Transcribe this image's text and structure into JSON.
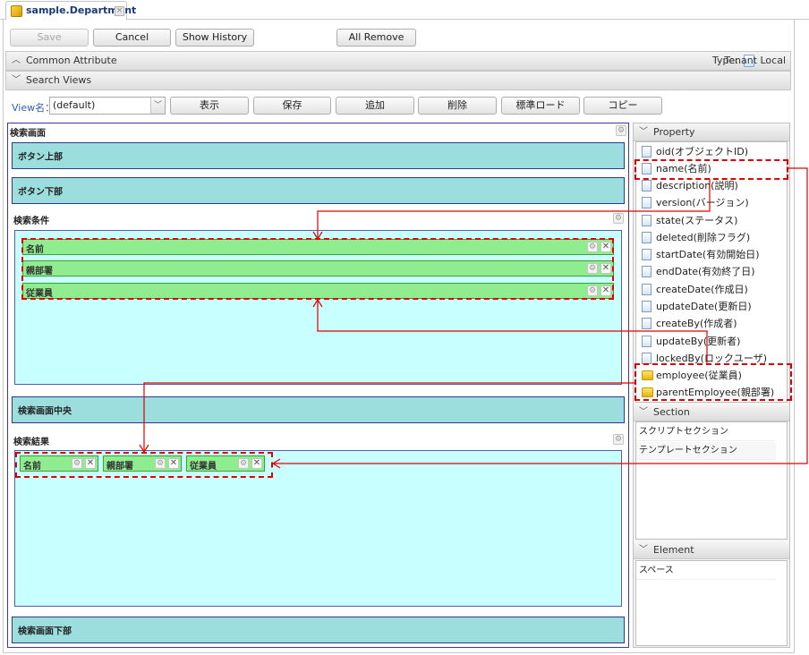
{
  "tab": {
    "title": "sample.Department",
    "icon": "entity-cube-icon"
  },
  "toolbar": {
    "save": "Save",
    "cancel": "Cancel",
    "show_history": "Show History",
    "all_remove": "All Remove"
  },
  "common_attribute": {
    "label": "Common Attribute",
    "type_label": "Type:",
    "type_value": "Tenant Local"
  },
  "search_views": {
    "label": "Search Views",
    "view_name_label": "View名：",
    "view_name_value": "(default)",
    "buttons": [
      "表示",
      "保存",
      "追加",
      "削除",
      "標準ロード",
      "コピー"
    ]
  },
  "canvas": {
    "search_screen_title": "検索画面",
    "button_top": "ボタン上部",
    "button_bottom": "ボタン下部",
    "conditions_title": "検索条件",
    "condition_rows": [
      "名前",
      "親部署",
      "従業員"
    ],
    "center": "検索画面中央",
    "results_title": "検索結果",
    "result_columns": [
      "名前",
      "親部署",
      "従業員"
    ],
    "bottom": "検索画面下部"
  },
  "property_panel": {
    "title": "Property",
    "items": [
      {
        "label": "oid(オブジェクトID)",
        "icon": "document-icon"
      },
      {
        "label": "name(名前)",
        "icon": "document-icon"
      },
      {
        "label": "description(説明)",
        "icon": "document-icon"
      },
      {
        "label": "version(バージョン)",
        "icon": "document-icon"
      },
      {
        "label": "state(ステータス)",
        "icon": "document-icon"
      },
      {
        "label": "deleted(削除フラグ)",
        "icon": "document-icon"
      },
      {
        "label": "startDate(有効開始日)",
        "icon": "document-icon"
      },
      {
        "label": "endDate(有効終了日)",
        "icon": "document-icon"
      },
      {
        "label": "createDate(作成日)",
        "icon": "document-icon"
      },
      {
        "label": "updateDate(更新日)",
        "icon": "document-icon"
      },
      {
        "label": "createBy(作成者)",
        "icon": "document-icon"
      },
      {
        "label": "updateBy(更新者)",
        "icon": "document-icon"
      },
      {
        "label": "lockedBy(ロックユーザ)",
        "icon": "document-icon"
      },
      {
        "label": "employee(従業員)",
        "icon": "folder-icon"
      },
      {
        "label": "parentEmployee(親部署)",
        "icon": "folder-icon"
      }
    ]
  },
  "section_panel": {
    "title": "Section",
    "items": [
      "スクリプトセクション",
      "テンプレートセクション"
    ]
  },
  "element_panel": {
    "title": "Element",
    "items": [
      "スペース"
    ]
  },
  "annotation": {
    "highlight_color": "#e00000"
  }
}
